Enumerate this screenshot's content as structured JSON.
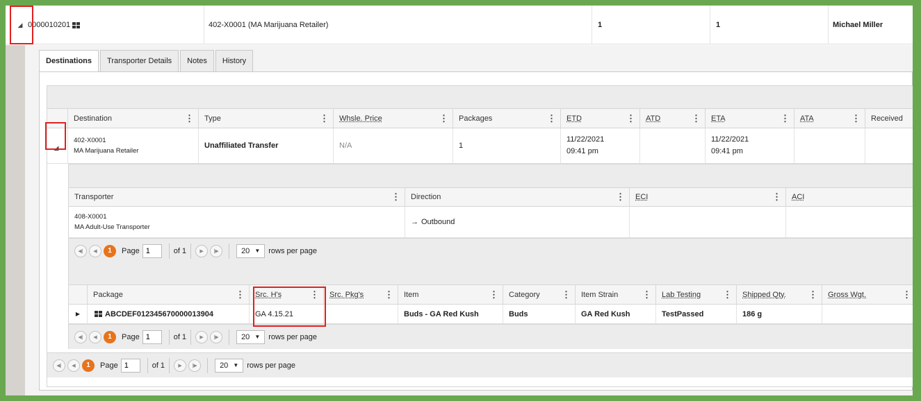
{
  "top_row": {
    "id": "0000010201",
    "facility": "402-X0001 (MA Marijuana Retailer)",
    "count1": "1",
    "count2": "1",
    "user": "Michael Miller"
  },
  "tabs": [
    "Destinations",
    "Transporter Details",
    "Notes",
    "History"
  ],
  "destinations": {
    "columns": [
      "Destination",
      "Type",
      "Whsle. Price",
      "Packages",
      "ETD",
      "ATD",
      "ETA",
      "ATA",
      "Received"
    ],
    "row": {
      "destination_code": "402-X0001",
      "destination_name": "MA Marijuana Retailer",
      "type": "Unaffiliated Transfer",
      "price": "N/A",
      "packages": "1",
      "etd_date": "11/22/2021",
      "etd_time": "09:41 pm",
      "atd": "",
      "eta_date": "11/22/2021",
      "eta_time": "09:41 pm",
      "ata": "",
      "received": ""
    }
  },
  "transporters": {
    "columns": [
      "Transporter",
      "Direction",
      "ECI",
      "ACI"
    ],
    "row": {
      "code": "408-X0001",
      "name": "MA Adult-Use Transporter",
      "direction": "Outbound",
      "eci": "",
      "aci": ""
    },
    "pager": {
      "current": "1",
      "page_label": "Page",
      "page_value": "1",
      "of_label": "of 1",
      "rows": "20",
      "rows_label": "rows per page"
    }
  },
  "packages": {
    "columns": [
      "Package",
      "Src. H's",
      "Src. Pkg's",
      "Item",
      "Category",
      "Item Strain",
      "Lab Testing",
      "Shipped Qty.",
      "Gross Wgt."
    ],
    "row": {
      "package": "ABCDEF012345670000013904",
      "src_h": "GA 4.15.21",
      "src_pkg": "",
      "item": "Buds - GA Red Kush",
      "category": "Buds",
      "strain": "GA Red Kush",
      "lab": "TestPassed",
      "qty": "186 g",
      "gross": ""
    },
    "pager": {
      "current": "1",
      "page_label": "Page",
      "page_value": "1",
      "of_label": "of 1",
      "rows": "20",
      "rows_label": "rows per page"
    }
  },
  "outer_pager": {
    "current": "1",
    "page_label": "Page",
    "page_value": "1",
    "of_label": "of 1",
    "rows": "20",
    "rows_label": "rows per page"
  },
  "colors": {
    "frame": "#6aa84f",
    "highlight": "#e02020",
    "page_current": "#e8731a"
  }
}
